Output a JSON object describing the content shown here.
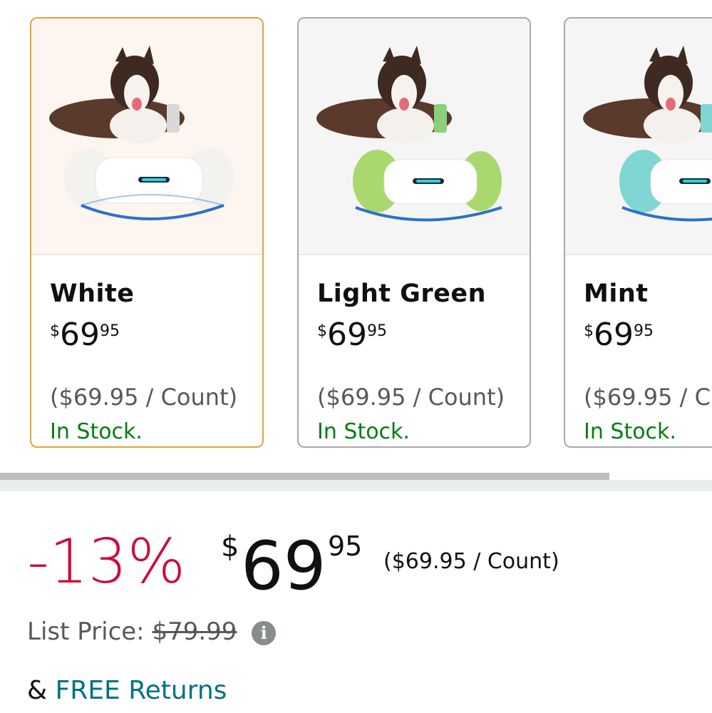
{
  "variants": [
    {
      "name": "White",
      "price_symbol": "$",
      "price_whole": "69",
      "price_fraction": "95",
      "unit_price": "($69.95 / Count)",
      "stock": "In Stock.",
      "end_color": "#f3f2ef",
      "selected": true
    },
    {
      "name": "Light Green",
      "price_symbol": "$",
      "price_whole": "69",
      "price_fraction": "95",
      "unit_price": "($69.95 / Count)",
      "stock": "In Stock.",
      "end_color": "#a9d86e",
      "selected": false
    },
    {
      "name": "Mint",
      "price_symbol": "$",
      "price_whole": "69",
      "price_fraction": "95",
      "unit_price": "($69.95 / C",
      "stock": "In Stock.",
      "end_color": "#7fd6d2",
      "selected": false
    }
  ],
  "deal": {
    "discount": "-13%",
    "price_symbol": "$",
    "price_whole": "69",
    "price_fraction": "95",
    "unit_price": "($69.95 / Count)"
  },
  "list_price": {
    "label": "List Price:",
    "value": "$79.99",
    "info_icon": "info-icon"
  },
  "returns": {
    "prefix": "&",
    "link": "FREE Returns"
  },
  "colors": {
    "selected_border": "#e3a23b",
    "discount": "#cc0c39",
    "in_stock": "#067d14",
    "link": "#007185"
  }
}
